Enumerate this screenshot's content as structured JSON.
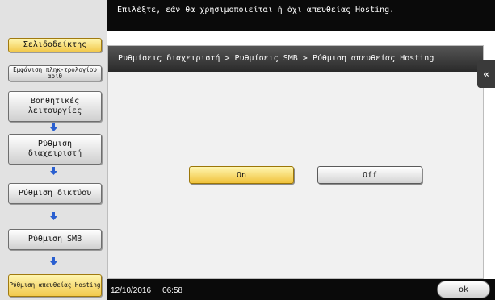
{
  "header": {
    "message": "Επιλέξτε, εάν θα χρησιμοποιείται ή όχι απευθείας Hosting."
  },
  "sidebar": {
    "bookmark_label": "Σελιδοδείκτης",
    "keypad_label": "Εμφάνιση πληκ-τρολογίου αριθ",
    "steps": [
      {
        "label": "Βοηθητικές λειτουργίες"
      },
      {
        "label": "Ρύθμιση διαχειριστή"
      },
      {
        "label": "Ρύθμιση δικτύου"
      },
      {
        "label": "Ρύθμιση SMB"
      },
      {
        "label": "Ρύθμιση απευθείας Hosting"
      }
    ]
  },
  "panel": {
    "breadcrumb": "Ρυθμίσεις διαχειριστή > Ρυθμίσεις SMB > Ρύθμιση απευθείας Hosting",
    "on_label": "On",
    "off_label": "Off",
    "selected": "On"
  },
  "side_tab_icon": "double-chevron-left-icon",
  "footer": {
    "date": "12/10/2016",
    "time": "06:58",
    "ok_label": "ok"
  },
  "colors": {
    "accent_yellow": "#f2c94c",
    "bar_black": "#0a0a0a"
  }
}
